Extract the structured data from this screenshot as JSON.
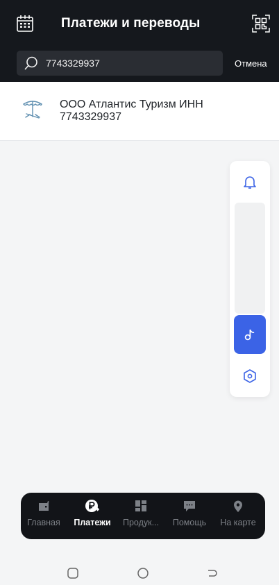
{
  "header": {
    "title": "Платежи и переводы",
    "calendar_icon": "calendar-icon",
    "qr_icon": "qr-scan-icon",
    "background": "#15181d"
  },
  "search": {
    "value": "7743329937",
    "icon": "search-icon",
    "cancel_label": "Отмена"
  },
  "results": [
    {
      "icon": "umbrella-beach-icon",
      "name": "ООО Атлантис Туризм ИНН",
      "inn": "7743329937"
    }
  ],
  "floating_panel": {
    "items": [
      "bell-icon",
      "tiktok-icon",
      "hexagon-icon"
    ],
    "accent": "#3b63e6"
  },
  "tabbar": {
    "tabs": [
      {
        "label": "Главная",
        "icon": "wallet-icon",
        "active": false
      },
      {
        "label": "Платежи",
        "icon": "payments-ruble-icon",
        "active": true
      },
      {
        "label": "Продук...",
        "icon": "products-grid-icon",
        "active": false
      },
      {
        "label": "Помощь",
        "icon": "chat-icon",
        "active": false
      },
      {
        "label": "На карте",
        "icon": "map-pin-icon",
        "active": false
      }
    ]
  },
  "system_nav": [
    "recent-apps-icon",
    "home-icon",
    "back-icon"
  ]
}
